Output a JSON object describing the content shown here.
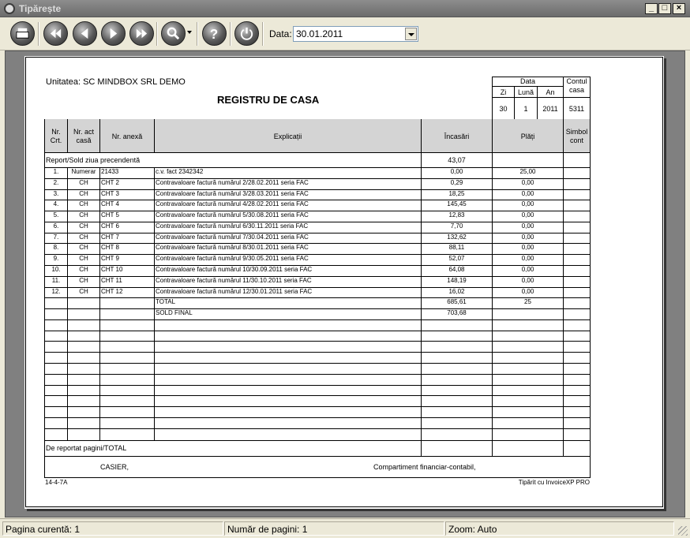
{
  "window": {
    "title": "Tipărește"
  },
  "toolbar": {
    "date_label": "Data:",
    "date_value": "30.01.2011"
  },
  "report": {
    "unit": "Unitatea: SC MINDBOX SRL DEMO",
    "title": "REGISTRU DE CASA",
    "date_box": {
      "header": "Data",
      "zi_label": "Zi",
      "luna_label": "Lună",
      "an_label": "An",
      "zi": "30",
      "luna": "1",
      "an": "2011",
      "contul_label": "Contul casa",
      "contul": "5311"
    },
    "columns": [
      "Nr. Crt.",
      "Nr. act casă",
      "Nr. anexă",
      "Explicații",
      "Încasări",
      "Plăți",
      "Simbol cont"
    ],
    "report_sold_label": "Report/Sold ziua precendentă",
    "report_sold_value": "43,07",
    "rows": [
      {
        "nr": "1.",
        "act": "Numerar",
        "anexa": "21433",
        "expl": "c.v. fact 2342342",
        "inc": "0,00",
        "plati": "25,00"
      },
      {
        "nr": "2.",
        "act": "CH",
        "anexa": "CHT 2",
        "expl": "Contravaloare factură numărul 2/28.02.2011 seria FAC",
        "inc": "0,29",
        "plati": "0,00"
      },
      {
        "nr": "3.",
        "act": "CH",
        "anexa": "CHT 3",
        "expl": "Contravaloare factură numărul 3/28.03.2011 seria FAC",
        "inc": "18,25",
        "plati": "0,00"
      },
      {
        "nr": "4.",
        "act": "CH",
        "anexa": "CHT 4",
        "expl": "Contravaloare factură numărul 4/28.02.2011 seria FAC",
        "inc": "145,45",
        "plati": "0,00"
      },
      {
        "nr": "5.",
        "act": "CH",
        "anexa": "CHT 5",
        "expl": "Contravaloare factură numărul 5/30.08.2011 seria FAC",
        "inc": "12,83",
        "plati": "0,00"
      },
      {
        "nr": "6.",
        "act": "CH",
        "anexa": "CHT 6",
        "expl": "Contravaloare factură numărul 6/30.11.2011 seria FAC",
        "inc": "7,70",
        "plati": "0,00"
      },
      {
        "nr": "7.",
        "act": "CH",
        "anexa": "CHT 7",
        "expl": "Contravaloare factură numărul 7/30.04.2011 seria FAC",
        "inc": "132,62",
        "plati": "0,00"
      },
      {
        "nr": "8.",
        "act": "CH",
        "anexa": "CHT 8",
        "expl": "Contravaloare factură numărul 8/30.01.2011 seria FAC",
        "inc": "88,11",
        "plati": "0,00"
      },
      {
        "nr": "9.",
        "act": "CH",
        "anexa": "CHT 9",
        "expl": "Contravaloare factură numărul 9/30.05.2011 seria FAC",
        "inc": "52,07",
        "plati": "0,00"
      },
      {
        "nr": "10.",
        "act": "CH",
        "anexa": "CHT 10",
        "expl": "Contravaloare factură numărul 10/30.09.2011 seria FAC",
        "inc": "64,08",
        "plati": "0,00"
      },
      {
        "nr": "11.",
        "act": "CH",
        "anexa": "CHT 11",
        "expl": "Contravaloare factură numărul 11/30.10.2011 seria FAC",
        "inc": "148,19",
        "plati": "0,00"
      },
      {
        "nr": "12.",
        "act": "CH",
        "anexa": "CHT 12",
        "expl": "Contravaloare factură numărul 12/30.01.2011 seria FAC",
        "inc": "16,02",
        "plati": "0,00"
      }
    ],
    "total_label": "TOTAL",
    "total_inc": "685,61",
    "total_plati": "25",
    "sold_final_label": "SOLD FINAL",
    "sold_final_value": "703,68",
    "de_reportat_label": "De reportat pagini/TOTAL",
    "casier_label": "CASIER,",
    "compartiment_label": "Compartiment financiar-contabil,",
    "form_code": "14-4-7A",
    "printed_with": "Tipărit cu InvoiceXP PRO"
  },
  "status": {
    "page_current": "Pagina curentă: 1",
    "page_count": "Număr de pagini: 1",
    "zoom": "Zoom: Auto"
  }
}
